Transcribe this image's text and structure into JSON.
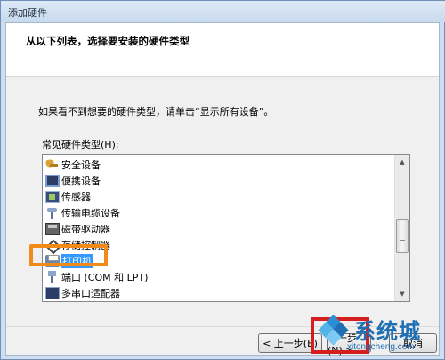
{
  "window": {
    "title": "添加硬件"
  },
  "header": {
    "heading": "从以下列表，选择要安装的硬件类型"
  },
  "main": {
    "hint": "如果看不到想要的硬件类型，请单击“显示所有设备”。",
    "list_label": "常见硬件类型(H):",
    "items": [
      {
        "label": "安全设备",
        "icon": "key-icon"
      },
      {
        "label": "便携设备",
        "icon": "portable-device-icon"
      },
      {
        "label": "传感器",
        "icon": "sensor-icon"
      },
      {
        "label": "传输电缆设备",
        "icon": "cable-device-icon"
      },
      {
        "label": "磁带驱动器",
        "icon": "tape-drive-icon"
      },
      {
        "label": "存储控制器",
        "icon": "storage-controller-icon"
      },
      {
        "label": "打印机",
        "icon": "printer-icon",
        "selected": true
      },
      {
        "label": "端口 (COM 和 LPT)",
        "icon": "port-icon"
      },
      {
        "label": "多串口适配器",
        "icon": "serial-adapter-icon"
      }
    ]
  },
  "footer": {
    "back_label": "< 上一步(B)",
    "next_label": "下一步(N) >",
    "cancel_label": "取消"
  },
  "watermark": {
    "text": "系统城",
    "url": "xitongcheng.com"
  },
  "colors": {
    "highlight": "#f28a1a",
    "red_box": "#d51e1e",
    "selection": "#3399ff"
  }
}
